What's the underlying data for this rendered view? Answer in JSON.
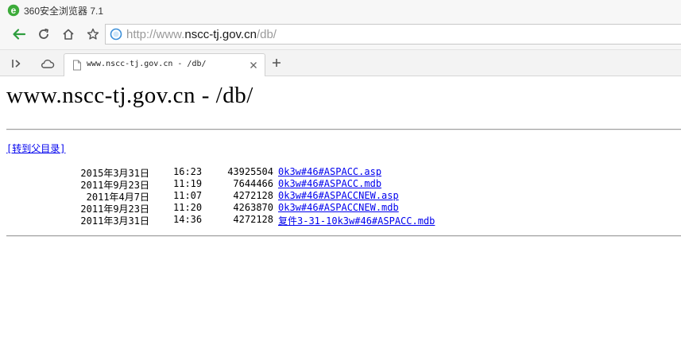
{
  "window": {
    "title": "360安全浏览器 7.1"
  },
  "address_bar": {
    "scheme": "http://www.",
    "host": "nscc-tj.gov.cn",
    "path": "/db/"
  },
  "tab": {
    "title": "www.nscc-tj.gov.cn - /db/"
  },
  "page": {
    "heading": "www.nscc-tj.gov.cn - /db/",
    "parent_link": "[转到父目录]",
    "files": [
      {
        "date": "2015年3月31日",
        "time": "16:23",
        "size": "43925504",
        "name": "0k3w#46#ASPACC.asp"
      },
      {
        "date": "2011年9月23日",
        "time": "11:19",
        "size": "7644466",
        "name": "0k3w#46#ASPACC.mdb"
      },
      {
        "date": "2011年4月7日",
        "time": "11:07",
        "size": "4272128",
        "name": "0k3w#46#ASPACCNEW.asp"
      },
      {
        "date": "2011年9月23日",
        "time": "11:20",
        "size": "4263870",
        "name": "0k3w#46#ASPACCNEW.mdb"
      },
      {
        "date": "2011年3月31日",
        "time": "14:36",
        "size": "4272128",
        "name": "复件3-31-10k3w#46#ASPACC.mdb"
      }
    ]
  },
  "colors": {
    "link": "#0000ee",
    "brand_green": "#3cab3a",
    "back_arrow": "#2f9e3f"
  },
  "icons": {
    "app": "360-browser-logo-icon",
    "back": "back-arrow-icon",
    "refresh": "refresh-icon",
    "home": "home-icon",
    "favorite": "star-icon",
    "site": "globe-icon",
    "sidebar_toggle": "sidebar-toggle-icon",
    "cloud": "cloud-icon",
    "tab_page": "page-icon",
    "tab_close": "close-icon",
    "new_tab": "plus-icon"
  }
}
